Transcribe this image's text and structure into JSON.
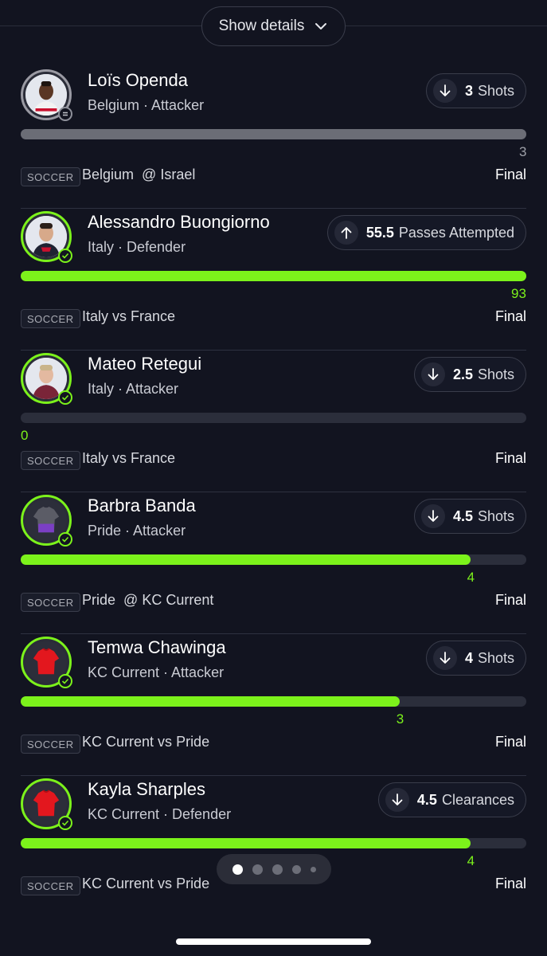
{
  "header": {
    "details_label": "Show details"
  },
  "picks": [
    {
      "name": "Loïs Openda",
      "team": "Belgium",
      "position": "Attacker",
      "direction": "down",
      "line": "3",
      "stat": "Shots",
      "result": "3",
      "progress": 1.0,
      "outcome": "push",
      "sport": "SOCCER",
      "match_team": "Belgium",
      "match_sep": "@",
      "match_opp": "Israel",
      "status": "Final"
    },
    {
      "name": "Alessandro Buongiorno",
      "team": "Italy",
      "position": "Defender",
      "direction": "up",
      "line": "55.5",
      "stat": "Passes Attempted",
      "result": "93",
      "progress": 1.0,
      "outcome": "won",
      "sport": "SOCCER",
      "match_team": "Italy",
      "match_sep": "vs",
      "match_opp": "France",
      "status": "Final"
    },
    {
      "name": "Mateo Retegui",
      "team": "Italy",
      "position": "Attacker",
      "direction": "down",
      "line": "2.5",
      "stat": "Shots",
      "result": "0",
      "progress": 0.0,
      "outcome": "won",
      "sport": "SOCCER",
      "match_team": "Italy",
      "match_sep": "vs",
      "match_opp": "France",
      "status": "Final"
    },
    {
      "name": "Barbra Banda",
      "team": "Pride",
      "position": "Attacker",
      "direction": "down",
      "line": "4.5",
      "stat": "Shots",
      "result": "4",
      "progress": 0.89,
      "outcome": "won",
      "sport": "SOCCER",
      "match_team": "Pride",
      "match_sep": "@",
      "match_opp": "KC Current",
      "status": "Final"
    },
    {
      "name": "Temwa Chawinga",
      "team": "KC Current",
      "position": "Attacker",
      "direction": "down",
      "line": "4",
      "stat": "Shots",
      "result": "3",
      "progress": 0.75,
      "outcome": "won",
      "sport": "SOCCER",
      "match_team": "KC Current",
      "match_sep": "vs",
      "match_opp": "Pride",
      "status": "Final"
    },
    {
      "name": "Kayla Sharples",
      "team": "KC Current",
      "position": "Defender",
      "direction": "down",
      "line": "4.5",
      "stat": "Clearances",
      "result": "4",
      "progress": 0.89,
      "outcome": "won",
      "sport": "SOCCER",
      "match_team": "KC Current",
      "match_sep": "vs",
      "match_opp": "Pride",
      "status": "Final"
    }
  ],
  "pager": {
    "count": 5,
    "active_index": 0
  },
  "colors": {
    "accent": "#7cf21b",
    "background": "#121420",
    "neutral": "#6b6d76"
  }
}
